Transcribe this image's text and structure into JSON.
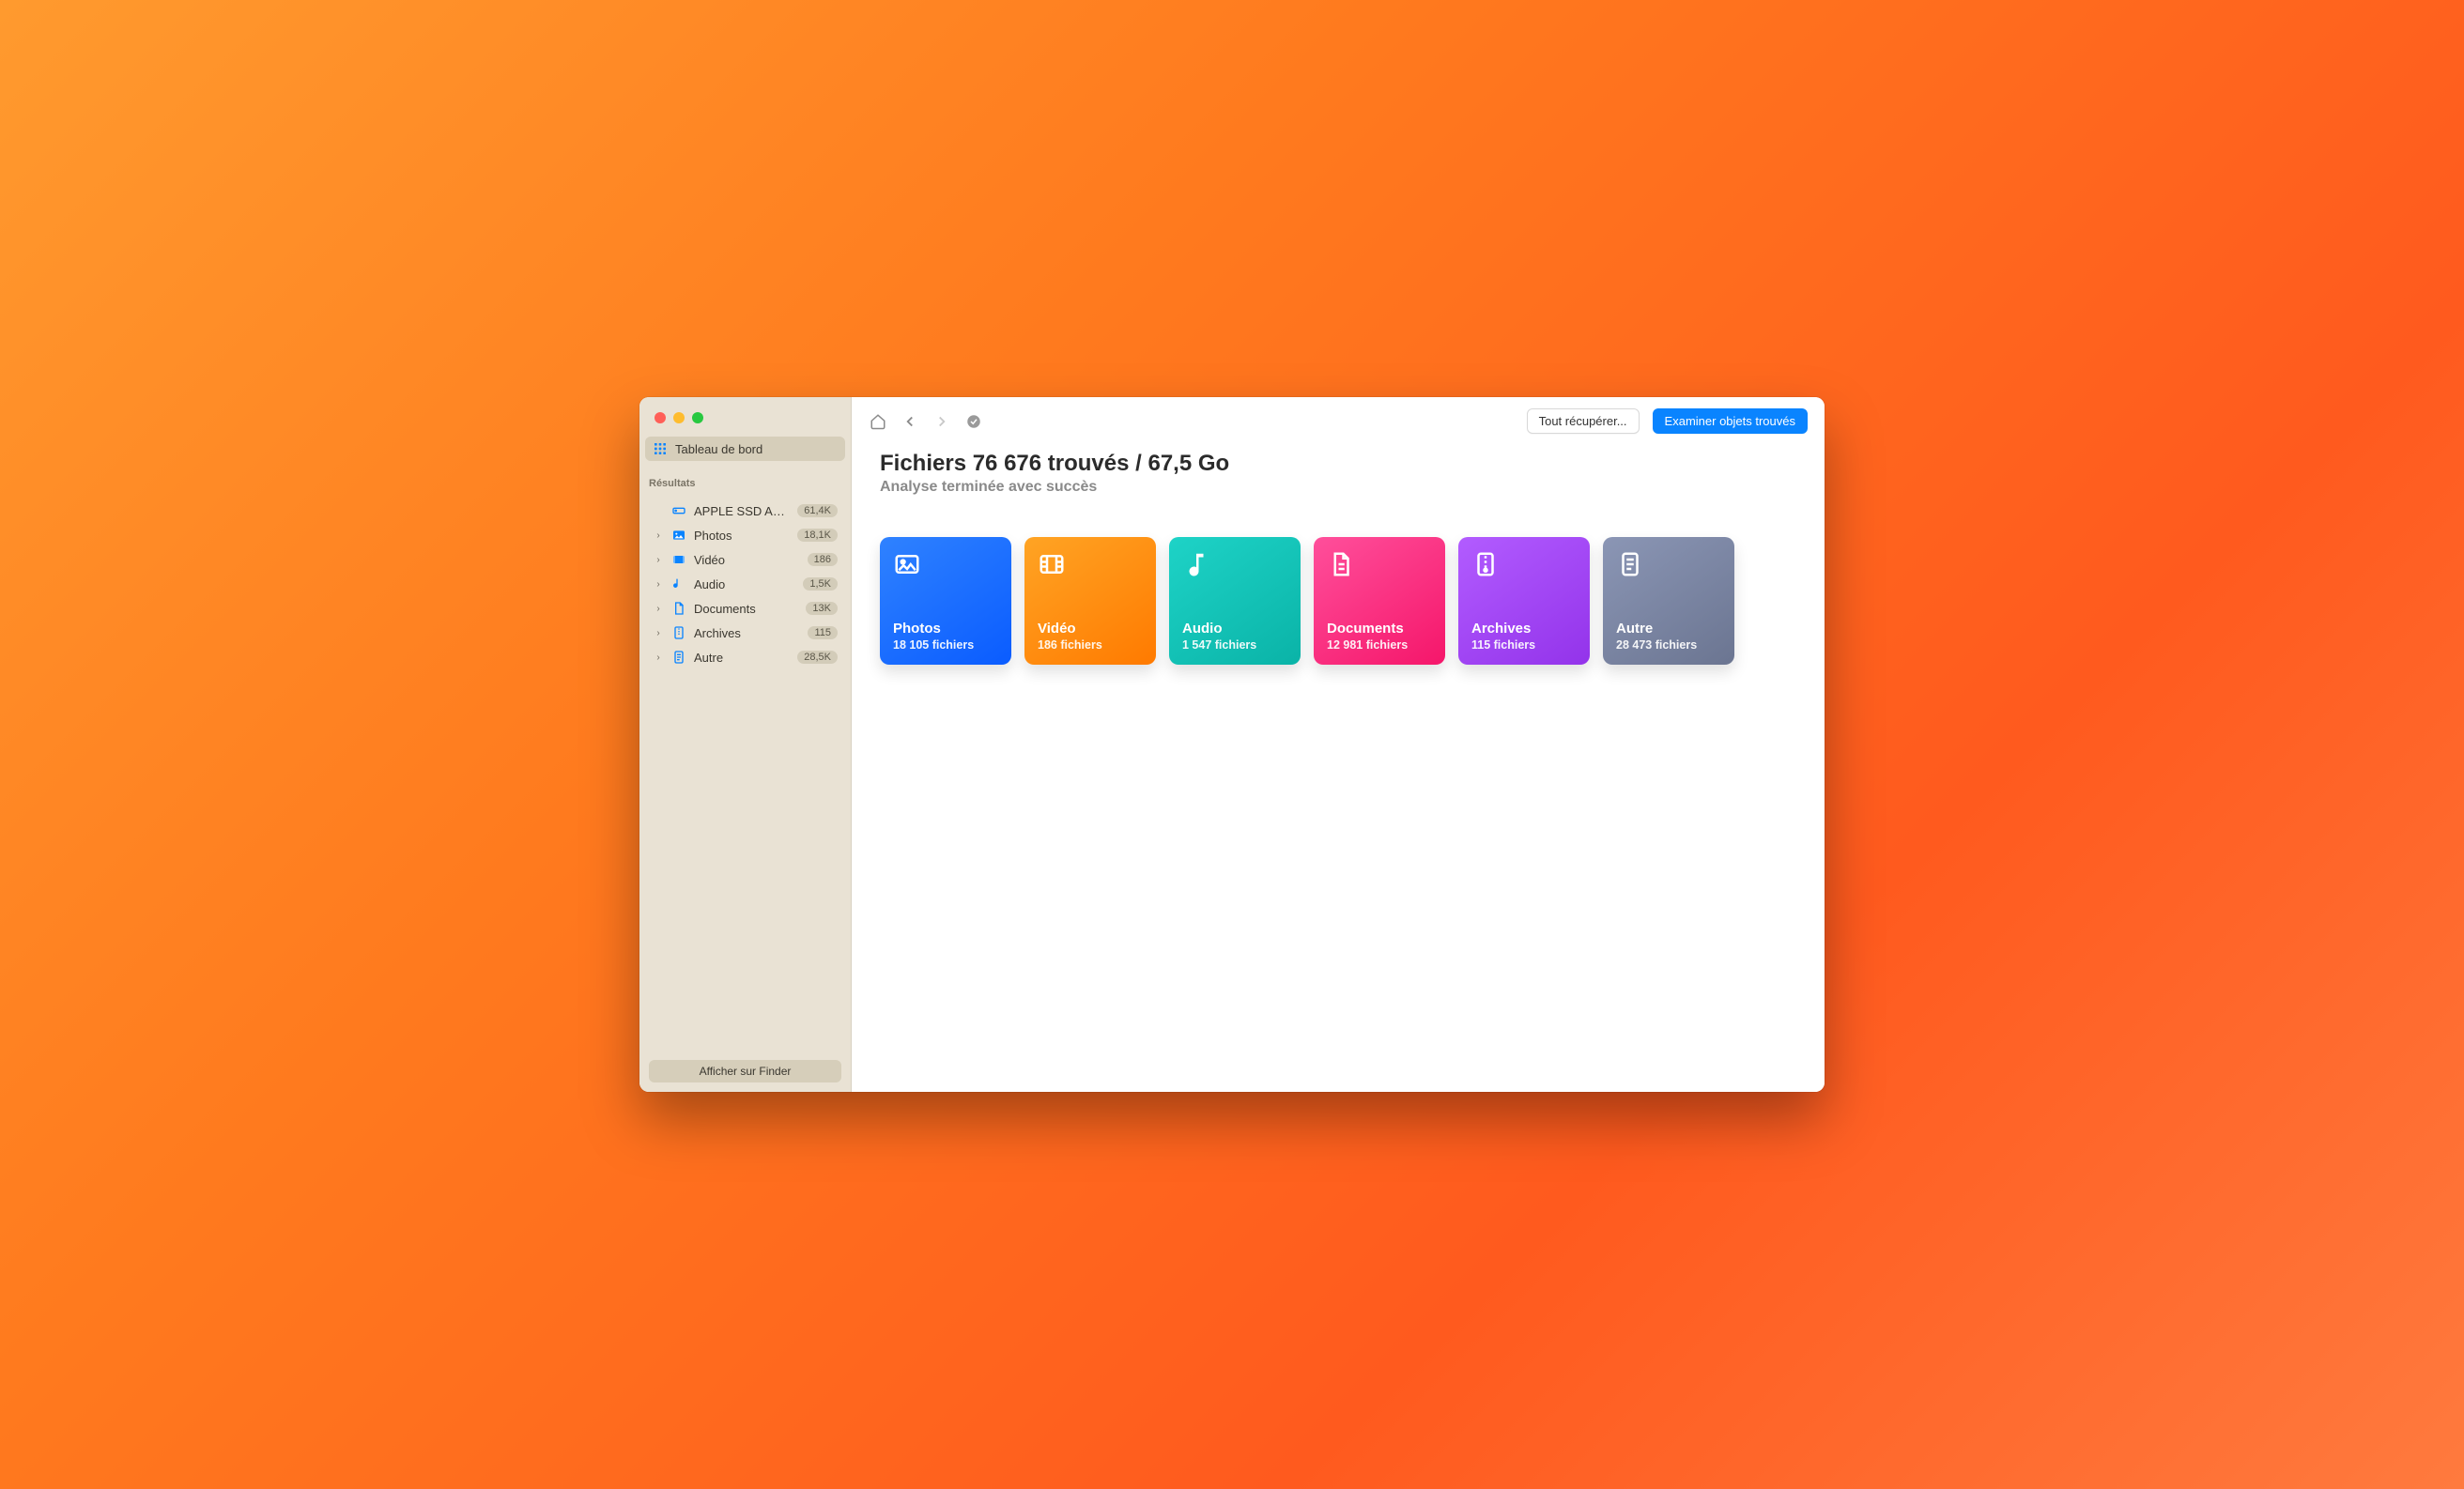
{
  "sidebar": {
    "dashboard_label": "Tableau de bord",
    "results_heading": "Résultats",
    "drive": {
      "label": "APPLE SSD AP0…",
      "count": "61,4K"
    },
    "items": [
      {
        "label": "Photos",
        "count": "18,1K"
      },
      {
        "label": "Vidéo",
        "count": "186"
      },
      {
        "label": "Audio",
        "count": "1,5K"
      },
      {
        "label": "Documents",
        "count": "13K"
      },
      {
        "label": "Archives",
        "count": "115"
      },
      {
        "label": "Autre",
        "count": "28,5K"
      }
    ],
    "finder_button": "Afficher sur Finder"
  },
  "toolbar": {
    "recover_all": "Tout récupérer...",
    "review": "Examiner objets trouvés"
  },
  "main": {
    "headline": "Fichiers 76 676 trouvés / 67,5 Go",
    "subhead": "Analyse terminée avec succès"
  },
  "cards": [
    {
      "title": "Photos",
      "subtitle": "18 105 fichiers"
    },
    {
      "title": "Vidéo",
      "subtitle": "186 fichiers"
    },
    {
      "title": "Audio",
      "subtitle": "1 547 fichiers"
    },
    {
      "title": "Documents",
      "subtitle": "12 981 fichiers"
    },
    {
      "title": "Archives",
      "subtitle": "115 fichiers"
    },
    {
      "title": "Autre",
      "subtitle": "28 473 fichiers"
    }
  ]
}
